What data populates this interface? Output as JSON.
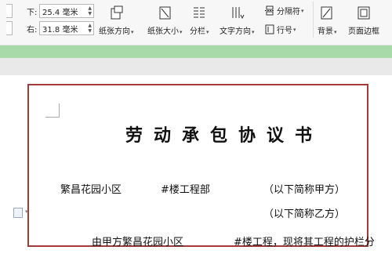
{
  "ribbon": {
    "margins": {
      "bottom_label": "下:",
      "bottom_value": "25.4 毫米",
      "right_label": "右:",
      "right_value": "31.8 毫米"
    },
    "tools": {
      "orientation": "纸张方向",
      "size": "纸张大小",
      "columns": "分栏",
      "text_direction": "文字方向",
      "separator": "分隔符",
      "line_number": "行号",
      "background": "背景",
      "page_border": "页面边框"
    },
    "caret": "▾"
  },
  "document": {
    "title": "劳动承包协议书",
    "line1_left": "繁昌花园小区",
    "line1_mid": "#楼工程部",
    "line1_right": "（以下简称甲方）",
    "line2_right": "（以下简称乙方）",
    "line3_left": "由甲方繁昌花园小区",
    "line3_right": "#楼工程，现将其工程的护栏分"
  },
  "colors": {
    "ribbon_bg": "#f7f7f7",
    "status_green": "#a8d9a8",
    "page_border": "#a33a3a"
  }
}
